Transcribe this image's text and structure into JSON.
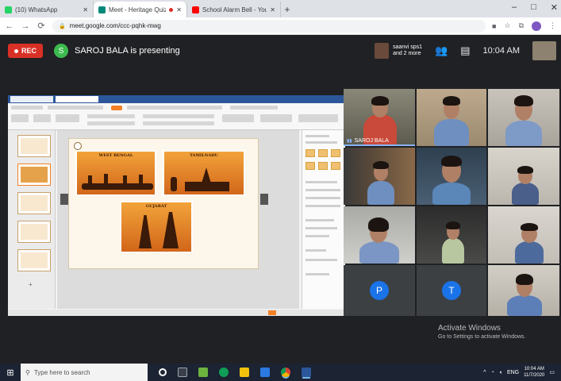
{
  "browser": {
    "tabs": [
      {
        "label": "(10) WhatsApp",
        "color": "#25d366",
        "active": false
      },
      {
        "label": "Meet - Heritage Quiz Vision",
        "color": "#00897b",
        "active": true
      },
      {
        "label": "School Alarm Bell - YouTube",
        "color": "#ff0000",
        "active": false
      }
    ],
    "new_tab": "+",
    "window_controls": {
      "minimize": "–",
      "maximize": "□",
      "close": "✕"
    },
    "url": "meet.google.com/ccc-pqhk-mwg"
  },
  "meet": {
    "rec_label": "REC",
    "presenter_initial": "S",
    "presenting_text": "SAROJ BALA is presenting",
    "participants_chip": {
      "line1": "saanvi sps1",
      "line2": "and 2 more"
    },
    "clock": "10:04 AM"
  },
  "slide": {
    "panels": [
      "WEST BENGAL",
      "TAMILNADU",
      "GUJARAT"
    ]
  },
  "participants": {
    "spotlight_name": "SAROJ BALA",
    "avatars": [
      {
        "initial": "P",
        "color": "#1a73e8"
      },
      {
        "initial": "T",
        "color": "#1a73e8"
      }
    ]
  },
  "watermark": {
    "title": "Activate Windows",
    "subtitle": "Go to Settings to activate Windows."
  },
  "taskbar": {
    "search_placeholder": "Type here to search",
    "time": "10:04 AM",
    "date": "11/7/2020",
    "lang": "ENG"
  }
}
